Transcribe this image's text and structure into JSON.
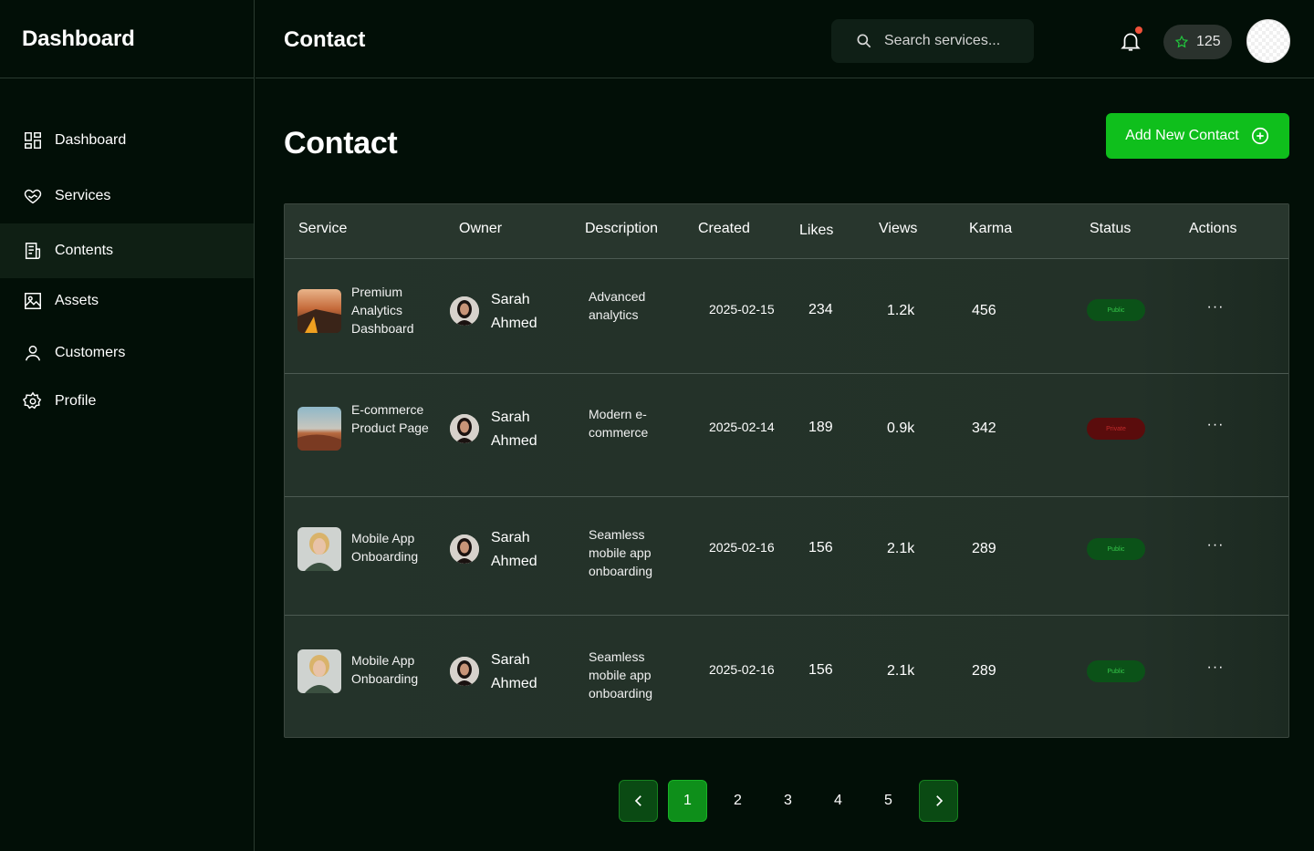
{
  "sidebar": {
    "brand": "Dashboard",
    "items": [
      {
        "label": "Dashboard",
        "icon": "grid-icon"
      },
      {
        "label": "Services",
        "icon": "heart-hand-icon"
      },
      {
        "label": "Contents",
        "icon": "document-icon"
      },
      {
        "label": "Assets",
        "icon": "image-icon"
      },
      {
        "label": "Customers",
        "icon": "user-icon"
      },
      {
        "label": "Profile",
        "icon": "gear-icon"
      }
    ],
    "active_index": 2
  },
  "topbar": {
    "title": "Contact",
    "search_placeholder": "Search services...",
    "karma_count": "125",
    "accent": "#0fbf1c",
    "notification_dot_color": "#f0513a"
  },
  "main": {
    "title": "Contact",
    "add_button_label": "Add New Contact"
  },
  "table": {
    "headers": [
      "Service",
      "Owner",
      "Description",
      "Created",
      "Likes",
      "Views",
      "Karma",
      "Status",
      "Actions"
    ],
    "rows": [
      {
        "service": "Premium Analytics Dashboard",
        "owner": "Sarah Ahmed",
        "description": "Advanced analytics",
        "created": "2025-02-15",
        "likes": "234",
        "views": "1.2k",
        "karma": "456",
        "status": "Public",
        "actions": "···"
      },
      {
        "service": "E-commerce Product Page",
        "owner": "Sarah Ahmed",
        "description": "Modern e-commerce",
        "created": "2025-02-14",
        "likes": "189",
        "views": "0.9k",
        "karma": "342",
        "status": "Private",
        "actions": "···"
      },
      {
        "service": "Mobile App Onboarding",
        "owner": "Sarah Ahmed",
        "description": "Seamless mobile app onboarding",
        "created": "2025-02-16",
        "likes": "156",
        "views": "2.1k",
        "karma": "289",
        "status": "Public",
        "actions": "···"
      },
      {
        "service": "Mobile App Onboarding",
        "owner": "Sarah Ahmed",
        "description": "Seamless mobile app onboarding",
        "created": "2025-02-16",
        "likes": "156",
        "views": "2.1k",
        "karma": "289",
        "status": "Public",
        "actions": "···"
      }
    ]
  },
  "pagination": {
    "pages": [
      "1",
      "2",
      "3",
      "4",
      "5"
    ],
    "current": "1"
  }
}
